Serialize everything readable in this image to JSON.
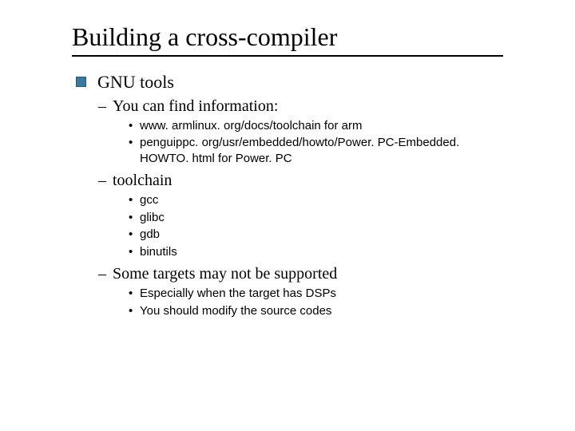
{
  "title": "Building a cross-compiler",
  "l1": {
    "text": "GNU tools"
  },
  "l2a": {
    "text": "You can find information:"
  },
  "l3a": [
    "www. armlinux. org/docs/toolchain for arm",
    "penguippc. org/usr/embedded/howto/Power. PC-Embedded. HOWTO. html for Power. PC"
  ],
  "l2b": {
    "text": "toolchain"
  },
  "l3b": [
    "gcc",
    "glibc",
    "gdb",
    "binutils"
  ],
  "l2c": {
    "text": "Some targets may not be supported"
  },
  "l3c": [
    "Especially when the target has DSPs",
    "You should modify the source codes"
  ]
}
